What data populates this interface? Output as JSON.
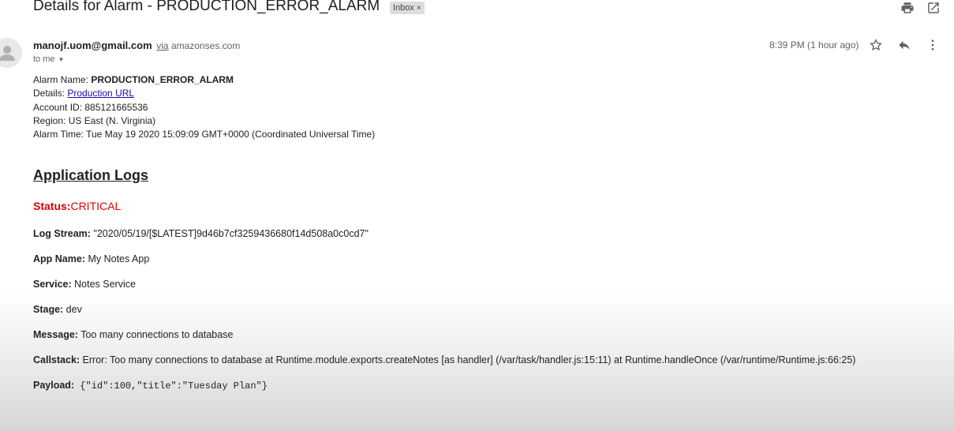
{
  "header": {
    "subject": "Details for Alarm - PRODUCTION_ERROR_ALARM",
    "badge_label": "Inbox",
    "badge_close": "×",
    "print_icon": "print-icon",
    "open_new_window_icon": "open-in-new-window-icon"
  },
  "message": {
    "sender_email": "manojf.uom@gmail.com",
    "via_label": "via",
    "via_domain": "amazonses.com",
    "to_label": "to me",
    "time": "8:39 PM (1 hour ago)",
    "star_icon": "star-icon",
    "reply_icon": "reply-icon",
    "more_icon": "more-vertical-icon",
    "avatar_icon": "person-avatar-icon"
  },
  "details": {
    "alarm_name_label": "Alarm Name: ",
    "alarm_name": "PRODUCTION_ERROR_ALARM",
    "details_label": "Details: ",
    "details_link": "Production URL",
    "account_id_label": "Account ID: ",
    "account_id": "885121665536",
    "region_label": "Region: ",
    "region": "US East (N. Virginia)",
    "alarm_time_label": "Alarm Time: ",
    "alarm_time": "Tue May 19 2020 15:09:09 GMT+0000 (Coordinated Universal Time)"
  },
  "logs": {
    "title": "Application Logs",
    "status_label": "Status:",
    "status_value": "CRITICAL",
    "log_stream_label": "Log Stream:",
    "log_stream": " \"2020/05/19/[$LATEST]9d46b7cf3259436680f14d508a0c0cd7\"",
    "app_name_label": "App Name:",
    "app_name": " My Notes App",
    "service_label": "Service:",
    "service": " Notes Service",
    "stage_label": "Stage:",
    "stage": " dev",
    "message_label": "Message:",
    "message": " Too many connections to database",
    "callstack_label": "Callstack:",
    "callstack": " Error: Too many connections to database at Runtime.module.exports.createNotes [as handler] (/var/task/handler.js:15:11) at Runtime.handleOnce (/var/runtime/Runtime.js:66:25)",
    "payload_label": "Payload:",
    "payload": " {\"id\":100,\"title\":\"Tuesday Plan\"}"
  },
  "colors": {
    "status_red": "#e00000",
    "link_blue": "#1a0dab",
    "badge_bg": "#dddddd"
  }
}
